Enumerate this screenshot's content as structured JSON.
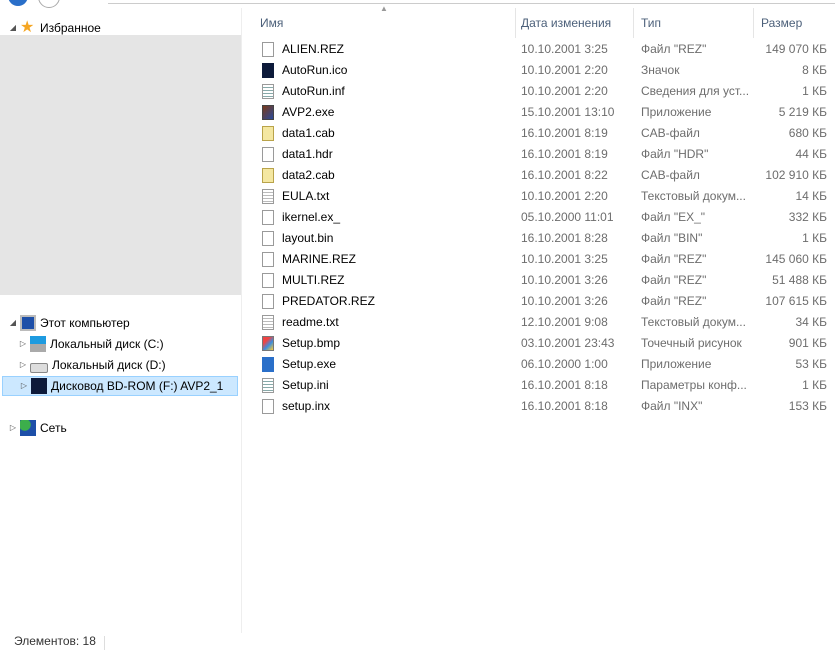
{
  "nav": {
    "favorites": "Избранное",
    "computer": "Этот компьютер",
    "drives": [
      "Локальный диск (C:)",
      "Локальный диск (D:)",
      "Дисковод BD-ROM (F:) AVP2_1"
    ],
    "network": "Сеть"
  },
  "columns": {
    "name": "Имя",
    "date": "Дата изменения",
    "type": "Тип",
    "size": "Размер"
  },
  "files": [
    {
      "name": "ALIEN.REZ",
      "date": "10.10.2001 3:25",
      "type": "Файл \"REZ\"",
      "size": "149 070 КБ",
      "icon": "blank"
    },
    {
      "name": "AutoRun.ico",
      "date": "10.10.2001 2:20",
      "type": "Значок",
      "size": "8 КБ",
      "icon": "image"
    },
    {
      "name": "AutoRun.inf",
      "date": "10.10.2001 2:20",
      "type": "Сведения для уст...",
      "size": "1 КБ",
      "icon": "settings"
    },
    {
      "name": "AVP2.exe",
      "date": "15.10.2001 13:10",
      "type": "Приложение",
      "size": "5 219 КБ",
      "icon": "exe"
    },
    {
      "name": "data1.cab",
      "date": "16.10.2001 8:19",
      "type": "CAB-файл",
      "size": "680 КБ",
      "icon": "cab"
    },
    {
      "name": "data1.hdr",
      "date": "16.10.2001 8:19",
      "type": "Файл \"HDR\"",
      "size": "44 КБ",
      "icon": "blank"
    },
    {
      "name": "data2.cab",
      "date": "16.10.2001 8:22",
      "type": "CAB-файл",
      "size": "102 910 КБ",
      "icon": "cab"
    },
    {
      "name": "EULA.txt",
      "date": "10.10.2001 2:20",
      "type": "Текстовый докум...",
      "size": "14 КБ",
      "icon": "text"
    },
    {
      "name": "ikernel.ex_",
      "date": "05.10.2000 11:01",
      "type": "Файл \"EX_\"",
      "size": "332 КБ",
      "icon": "blank"
    },
    {
      "name": "layout.bin",
      "date": "16.10.2001 8:28",
      "type": "Файл \"BIN\"",
      "size": "1 КБ",
      "icon": "blank"
    },
    {
      "name": "MARINE.REZ",
      "date": "10.10.2001 3:25",
      "type": "Файл \"REZ\"",
      "size": "145 060 КБ",
      "icon": "blank"
    },
    {
      "name": "MULTI.REZ",
      "date": "10.10.2001 3:26",
      "type": "Файл \"REZ\"",
      "size": "51 488 КБ",
      "icon": "blank"
    },
    {
      "name": "PREDATOR.REZ",
      "date": "10.10.2001 3:26",
      "type": "Файл \"REZ\"",
      "size": "107 615 КБ",
      "icon": "blank"
    },
    {
      "name": "readme.txt",
      "date": "12.10.2001 9:08",
      "type": "Текстовый докум...",
      "size": "34 КБ",
      "icon": "text"
    },
    {
      "name": "Setup.bmp",
      "date": "03.10.2001 23:43",
      "type": "Точечный рисунок",
      "size": "901 КБ",
      "icon": "bitmap"
    },
    {
      "name": "Setup.exe",
      "date": "06.10.2000 1:00",
      "type": "Приложение",
      "size": "53 КБ",
      "icon": "setup"
    },
    {
      "name": "Setup.ini",
      "date": "16.10.2001 8:18",
      "type": "Параметры конф...",
      "size": "1 КБ",
      "icon": "settings"
    },
    {
      "name": "setup.inx",
      "date": "16.10.2001 8:18",
      "type": "Файл \"INX\"",
      "size": "153 КБ",
      "icon": "blank"
    }
  ],
  "status": {
    "count": "Элементов: 18"
  }
}
